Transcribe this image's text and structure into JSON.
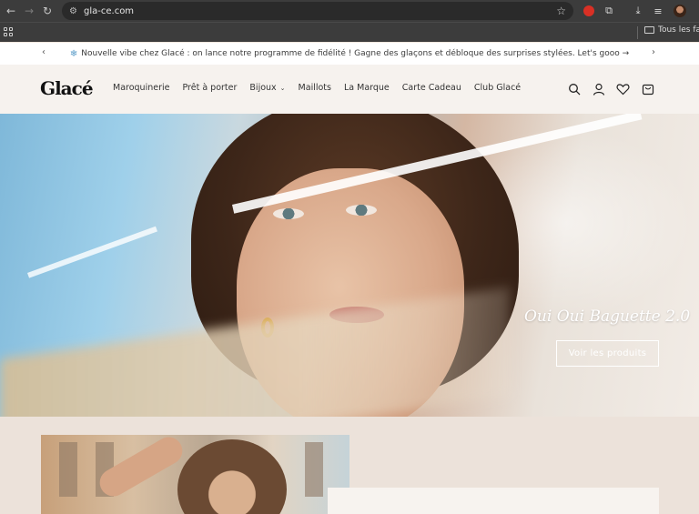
{
  "browser": {
    "url": "gla-ce.com",
    "bookmarks_folder": "Tous les favoris",
    "extension_badge_color": "#d93025"
  },
  "announcement": {
    "icon": "snowflake-icon",
    "text": "Nouvelle vibe chez Glacé : on lance notre programme de fidélité ! Gagne des glaçons et débloque des surprises stylées. Let's gooo →"
  },
  "header": {
    "logo": "Glacé",
    "menu": [
      {
        "label": "Maroquinerie"
      },
      {
        "label": "Prêt à porter"
      },
      {
        "label": "Bijoux",
        "has_dropdown": true
      },
      {
        "label": "Maillots"
      },
      {
        "label": "La Marque"
      },
      {
        "label": "Carte Cadeau"
      },
      {
        "label": "Club Glacé"
      }
    ],
    "icons": [
      "search-icon",
      "account-icon",
      "wishlist-heart-icon",
      "cart-bag-icon"
    ]
  },
  "hero": {
    "title": "Oui Oui Baguette 2.0",
    "button": "Voir les produits"
  },
  "colors": {
    "page_bg": "#efe6de",
    "header_bg": "#f6f2ee",
    "text": "#333333"
  }
}
